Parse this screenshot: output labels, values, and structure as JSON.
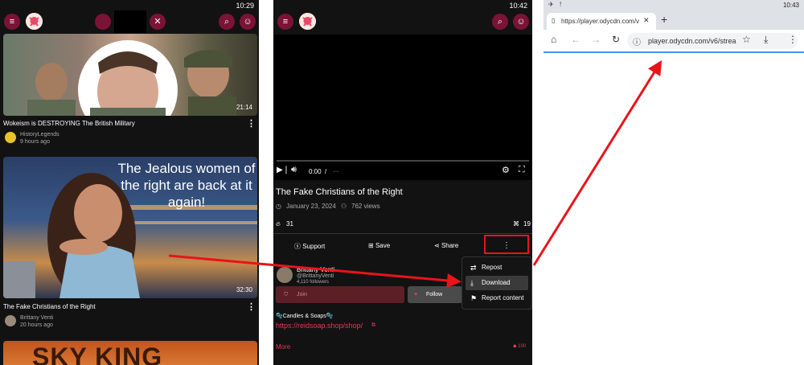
{
  "panel1": {
    "status_time": "10:29",
    "videos": [
      {
        "title": "Wokeism is DESTROYING The British Military",
        "channel": "HistoryLegends",
        "age": "9 hours ago",
        "duration": "21:14"
      },
      {
        "title": "The Fake Christians of the Right",
        "channel": "Brittany Venti",
        "age": "20 hours ago",
        "duration": "32:30",
        "overlay_text": "The Jealous women of the right are back at it again!"
      },
      {
        "thumb_text": "SKY KING"
      }
    ]
  },
  "panel2": {
    "status_time": "10:42",
    "player": {
      "time": "0:00",
      "sep": "/"
    },
    "title": "The Fake Christians of the Right",
    "date": "January 23, 2024",
    "views": "762 views",
    "likes": "31",
    "reposts": "19",
    "actions": {
      "support": "Support",
      "save": "Save",
      "share": "Share"
    },
    "channel": {
      "name": "Brittany Venti",
      "handle": "@BrittanyVenti",
      "followers": "4,110 followers"
    },
    "join_label": "Join",
    "follow_label": "Follow",
    "desc_line": "🫧Candles & Soaps🫧",
    "desc_link": "https://reidsoap.shop/shop/",
    "more_label": "More",
    "more_count": "100",
    "menu": [
      "Repost",
      "Download",
      "Report content"
    ]
  },
  "panel3": {
    "status_time": "10:43",
    "tab_title": "https://player.odycdn.com/v",
    "url": "player.odycdn.com/v6/strea"
  },
  "colors": {
    "accent": "#7a1335",
    "annotation": "#e8141b",
    "dark_bg": "#121212",
    "link": "#e23a5a"
  }
}
